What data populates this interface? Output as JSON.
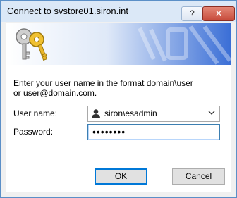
{
  "window": {
    "title": "Connect to svstore01.siron.int",
    "help_label": "?",
    "close_label": "✕"
  },
  "dialog": {
    "instruction": "Enter your user name in the format domain\\user or user@domain.com.",
    "username_label": "User name:",
    "username_value": "siron\\esadmin",
    "password_label": "Password:",
    "password_value": "••••••••",
    "ok_label": "OK",
    "cancel_label": "Cancel"
  },
  "colors": {
    "banner_accent": "#3a6ed6",
    "titlebar": "#dbe8f7",
    "close_button": "#c74a3a"
  }
}
